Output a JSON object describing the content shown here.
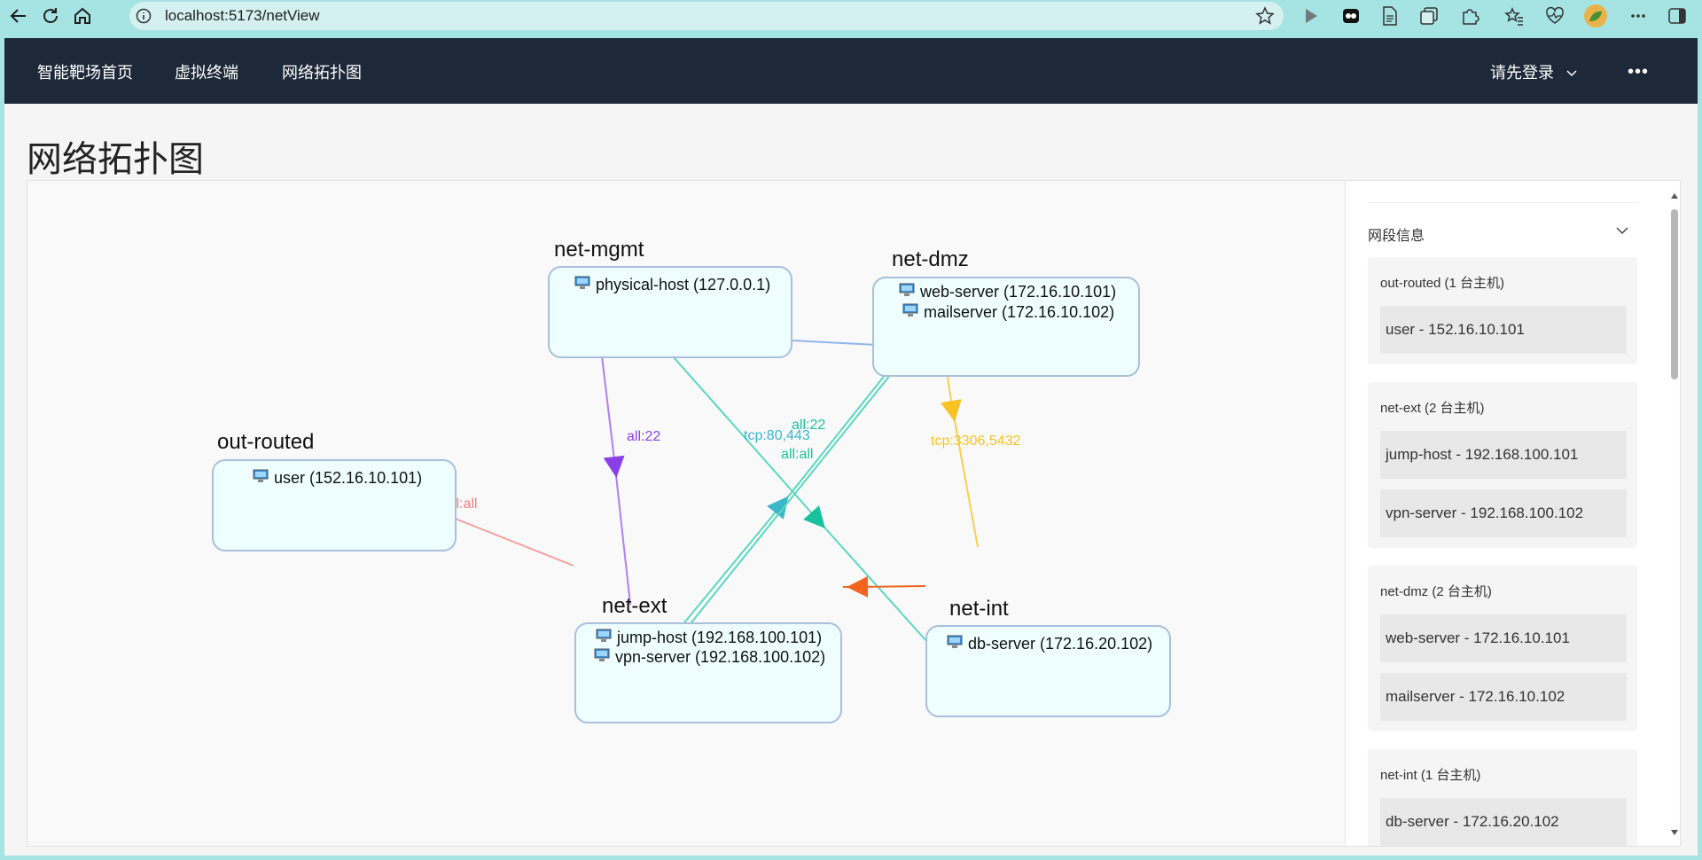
{
  "browser": {
    "url": "localhost:5173/netView",
    "icons": [
      "back-icon",
      "reload-icon",
      "home-icon",
      "info-icon",
      "star-icon",
      "play-icon",
      "extension-icon",
      "document-icon",
      "collections-icon",
      "puzzle-icon",
      "favorites-icon",
      "heartbeat-icon",
      "profile-avatar",
      "more-icon",
      "sidebar-icon"
    ]
  },
  "topnav": {
    "items": [
      "智能靶场首页",
      "虚拟终端",
      "网络拓扑图"
    ],
    "login_label": "请先登录",
    "more_label": "•••"
  },
  "page": {
    "title": "网络拓扑图"
  },
  "topology": {
    "nodes": [
      {
        "name": "net-mgmt",
        "hosts": [
          "physical-host (127.0.0.1)"
        ]
      },
      {
        "name": "net-dmz",
        "hosts": [
          "web-server (172.16.10.101)",
          "mailserver (172.16.10.102)"
        ]
      },
      {
        "name": "out-routed",
        "hosts": [
          "user (152.16.10.101)"
        ]
      },
      {
        "name": "net-ext",
        "hosts": [
          "jump-host (192.168.100.101)",
          "vpn-server (192.168.100.102)"
        ]
      },
      {
        "name": "net-int",
        "hosts": [
          "db-server (172.16.20.102)"
        ]
      }
    ],
    "edges": [
      {
        "from": "net-mgmt",
        "to": "net-dmz",
        "label": "",
        "color": "#8fb6ee"
      },
      {
        "from": "net-mgmt",
        "to": "net-ext",
        "label": "all:22",
        "color": "#8b3fe8"
      },
      {
        "from": "net-mgmt",
        "to": "net-int",
        "label": "all:22",
        "color": "#3dd2b4"
      },
      {
        "from": "net-ext",
        "to": "net-dmz",
        "label": "tcp:80,443",
        "color": "#3ab7c9"
      },
      {
        "from": "net-dmz",
        "to": "net-ext",
        "label": "all:all",
        "color": "#3dd2b4"
      },
      {
        "from": "net-dmz",
        "to": "net-int",
        "label": "tcp:3306,5432",
        "color": "#f8c322"
      },
      {
        "from": "net-ext",
        "to": "out-routed",
        "label": "all:all",
        "color": "#f47c7c"
      },
      {
        "from": "net-int",
        "to": "net-ext",
        "label": "",
        "color": "#f2651e"
      }
    ]
  },
  "sidebar": {
    "heading": "网段信息",
    "segments": [
      {
        "title": "out-routed (1 台主机)",
        "hosts": [
          "user - 152.16.10.101"
        ]
      },
      {
        "title": "net-ext (2 台主机)",
        "hosts": [
          "jump-host - 192.168.100.101",
          "vpn-server - 192.168.100.102"
        ]
      },
      {
        "title": "net-dmz (2 台主机)",
        "hosts": [
          "web-server - 172.16.10.101",
          "mailserver - 172.16.10.102"
        ]
      },
      {
        "title": "net-int (1 台主机)",
        "hosts": [
          "db-server - 172.16.20.102"
        ]
      }
    ]
  }
}
